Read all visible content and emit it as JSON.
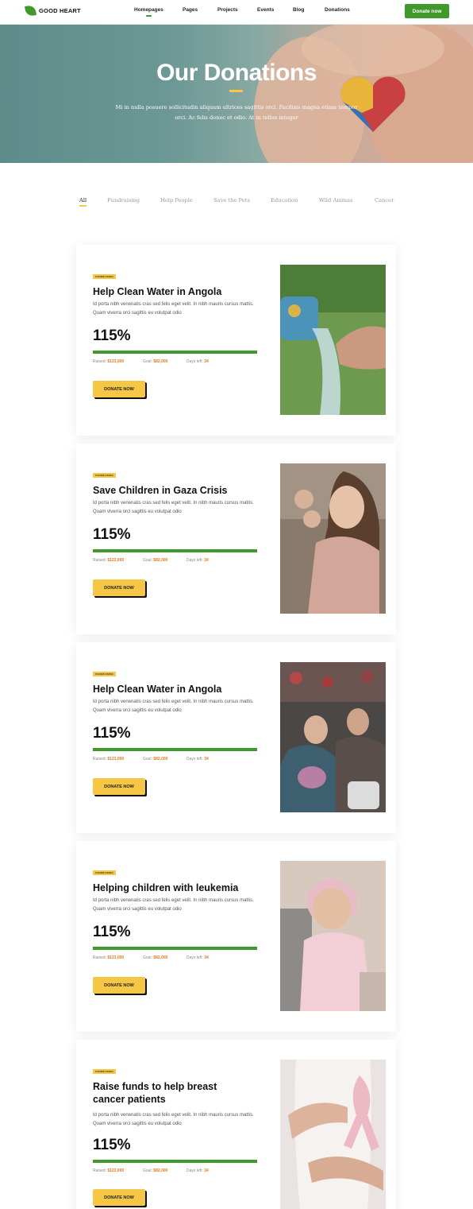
{
  "header": {
    "logo_text": "GOOD HEART",
    "nav": [
      "Homepages",
      "Pages",
      "Projects",
      "Events",
      "Blog",
      "Donations"
    ],
    "donate_button": "Donate now"
  },
  "hero": {
    "title": "Our Donations",
    "subtitle": "Mi in nulla posuere sollicitudin aliquam ultrices sagittis orci. Facilisis magna etiam tempor orci. Ac felis donec et odio. At in tellus integer"
  },
  "filters": [
    "All",
    "Fundraising",
    "Help People",
    "Save the Pets",
    "Education",
    "Wild Animas",
    "Cancer"
  ],
  "colors": {
    "brand_green": "#3f9a2b",
    "accent_yellow": "#f6c744",
    "value_orange": "#e07b24"
  },
  "cards": [
    {
      "tag": "FUNDRAISING",
      "title": "Help Clean Water in Angola",
      "desc": "Id porta nibh venenatis cras sed felis eget velit. In nibh mauris cursus mattis. Quam viverra orci sagittis eu volutpat odio",
      "percent": "115%",
      "raised_label": "Raised:",
      "raised": "$123,000",
      "goal_label": "Goal:",
      "goal": "$82,000",
      "days_label": "Days left:",
      "days": "34",
      "button": "DONATE NOW",
      "image": "water-pouring-into-hands-photo"
    },
    {
      "tag": "FUNDRAISING",
      "title": "Save Children in Gaza Crisis",
      "desc": "Id porta nibh venenatis cras sed felis eget velit. In nibh mauris cursus mattis. Quam viverra orci sagittis eu volutpat odio",
      "percent": "115%",
      "raised_label": "Raised:",
      "raised": "$123,000",
      "goal_label": "Goal:",
      "goal": "$82,000",
      "days_label": "Days left:",
      "days": "34",
      "button": "DONATE NOW",
      "image": "children-portrait-photo"
    },
    {
      "tag": "FUNDRAISING",
      "title": "Help Clean Water in Angola",
      "desc": "Id porta nibh venenatis cras sed felis eget velit. In nibh mauris cursus mattis. Quam viverra orci sagittis eu volutpat odio",
      "percent": "115%",
      "raised_label": "Raised:",
      "raised": "$123,000",
      "goal_label": "Goal:",
      "goal": "$82,000",
      "days_label": "Days left:",
      "days": "34",
      "button": "DONATE NOW",
      "image": "refugee-children-crowd-photo"
    },
    {
      "tag": "FUNDRAISING",
      "title": "Helping children with leukemia",
      "desc": "Id porta nibh venenatis cras sed felis eget velit. In nibh mauris cursus mattis. Quam viverra orci sagittis eu volutpat odio",
      "percent": "115%",
      "raised_label": "Raised:",
      "raised": "$123,000",
      "goal_label": "Goal:",
      "goal": "$82,000",
      "days_label": "Days left:",
      "days": "34",
      "button": "DONATE NOW",
      "image": "girl-with-headscarf-photo"
    },
    {
      "tag": "FUNDRAISING",
      "title": "Raise funds to help breast cancer patients",
      "desc": "Id porta nibh venenatis cras sed felis eget velit. In nibh mauris cursus mattis. Quam viverra orci sagittis eu volutpat odio",
      "percent": "115%",
      "raised_label": "Raised:",
      "raised": "$123,000",
      "goal_label": "Goal:",
      "goal": "$82,000",
      "days_label": "Days left:",
      "days": "34",
      "button": "DONATE NOW",
      "image": "pink-ribbon-photo"
    }
  ]
}
